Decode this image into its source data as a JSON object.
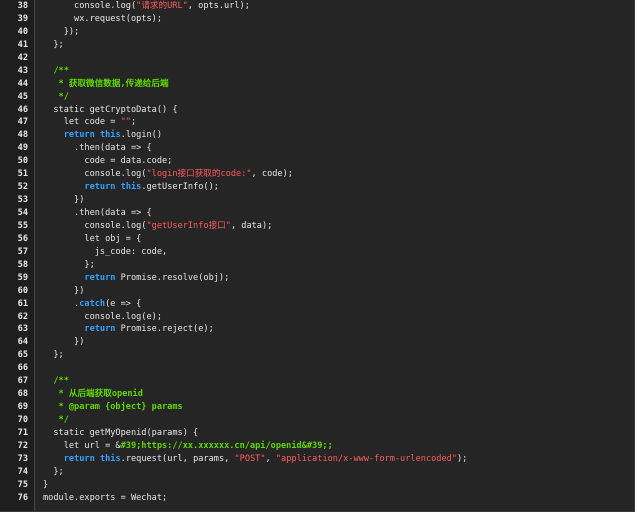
{
  "editor": {
    "lines": [
      {
        "num": "38",
        "tokens": [
          {
            "t": "      console.log(",
            "c": ""
          },
          {
            "t": "\"请求的URL\"",
            "c": "str"
          },
          {
            "t": ", opts.url);",
            "c": ""
          }
        ]
      },
      {
        "num": "39",
        "tokens": [
          {
            "t": "      wx.request(opts);",
            "c": ""
          }
        ]
      },
      {
        "num": "40",
        "tokens": [
          {
            "t": "    });",
            "c": ""
          }
        ]
      },
      {
        "num": "41",
        "tokens": [
          {
            "t": "  };",
            "c": ""
          }
        ]
      },
      {
        "num": "42",
        "tokens": []
      },
      {
        "num": "43",
        "tokens": [
          {
            "t": "  /**",
            "c": "cm"
          }
        ]
      },
      {
        "num": "44",
        "tokens": [
          {
            "t": "   * 获取微信数据,传递给后端",
            "c": "cm"
          }
        ]
      },
      {
        "num": "45",
        "tokens": [
          {
            "t": "   */",
            "c": "cm"
          }
        ]
      },
      {
        "num": "46",
        "tokens": [
          {
            "t": "  static getCryptoData() {",
            "c": ""
          }
        ]
      },
      {
        "num": "47",
        "tokens": [
          {
            "t": "    let code = ",
            "c": ""
          },
          {
            "t": "\"\"",
            "c": "str"
          },
          {
            "t": ";",
            "c": ""
          }
        ]
      },
      {
        "num": "48",
        "tokens": [
          {
            "t": "    ",
            "c": ""
          },
          {
            "t": "return",
            "c": "kw"
          },
          {
            "t": " ",
            "c": ""
          },
          {
            "t": "this",
            "c": "kw"
          },
          {
            "t": ".login()",
            "c": ""
          }
        ]
      },
      {
        "num": "49",
        "tokens": [
          {
            "t": "      .then(data => {",
            "c": ""
          }
        ]
      },
      {
        "num": "50",
        "tokens": [
          {
            "t": "        code = data.code;",
            "c": ""
          }
        ]
      },
      {
        "num": "51",
        "tokens": [
          {
            "t": "        console.log(",
            "c": ""
          },
          {
            "t": "\"login接口获取的code:\"",
            "c": "str"
          },
          {
            "t": ", code);",
            "c": ""
          }
        ]
      },
      {
        "num": "52",
        "tokens": [
          {
            "t": "        ",
            "c": ""
          },
          {
            "t": "return",
            "c": "kw"
          },
          {
            "t": " ",
            "c": ""
          },
          {
            "t": "this",
            "c": "kw"
          },
          {
            "t": ".getUserInfo();",
            "c": ""
          }
        ]
      },
      {
        "num": "53",
        "tokens": [
          {
            "t": "      })",
            "c": ""
          }
        ]
      },
      {
        "num": "54",
        "tokens": [
          {
            "t": "      .then(data => {",
            "c": ""
          }
        ]
      },
      {
        "num": "55",
        "tokens": [
          {
            "t": "        console.log(",
            "c": ""
          },
          {
            "t": "\"getUserInfo接口\"",
            "c": "str"
          },
          {
            "t": ", data);",
            "c": ""
          }
        ]
      },
      {
        "num": "56",
        "tokens": [
          {
            "t": "        let obj = {",
            "c": ""
          }
        ]
      },
      {
        "num": "57",
        "tokens": [
          {
            "t": "          js_code: code,",
            "c": ""
          }
        ]
      },
      {
        "num": "58",
        "tokens": [
          {
            "t": "        };",
            "c": ""
          }
        ]
      },
      {
        "num": "59",
        "tokens": [
          {
            "t": "        ",
            "c": ""
          },
          {
            "t": "return",
            "c": "kw"
          },
          {
            "t": " Promise.resolve(obj);",
            "c": ""
          }
        ]
      },
      {
        "num": "60",
        "tokens": [
          {
            "t": "      })",
            "c": ""
          }
        ]
      },
      {
        "num": "61",
        "tokens": [
          {
            "t": "      .",
            "c": ""
          },
          {
            "t": "catch",
            "c": "kw"
          },
          {
            "t": "(e => {",
            "c": ""
          }
        ]
      },
      {
        "num": "62",
        "tokens": [
          {
            "t": "        console.log(e);",
            "c": ""
          }
        ]
      },
      {
        "num": "63",
        "tokens": [
          {
            "t": "        ",
            "c": ""
          },
          {
            "t": "return",
            "c": "kw"
          },
          {
            "t": " Promise.reject(e);",
            "c": ""
          }
        ]
      },
      {
        "num": "64",
        "tokens": [
          {
            "t": "      })",
            "c": ""
          }
        ]
      },
      {
        "num": "65",
        "tokens": [
          {
            "t": "  };",
            "c": ""
          }
        ]
      },
      {
        "num": "66",
        "tokens": []
      },
      {
        "num": "67",
        "tokens": [
          {
            "t": "  /**",
            "c": "cm"
          }
        ]
      },
      {
        "num": "68",
        "tokens": [
          {
            "t": "   * 从后端获取openid",
            "c": "cm"
          }
        ]
      },
      {
        "num": "69",
        "tokens": [
          {
            "t": "   * @param {object} params",
            "c": "cm"
          }
        ]
      },
      {
        "num": "70",
        "tokens": [
          {
            "t": "   */",
            "c": "cm"
          }
        ]
      },
      {
        "num": "71",
        "tokens": [
          {
            "t": "  static getMyOpenid(params) {",
            "c": ""
          }
        ]
      },
      {
        "num": "72",
        "tokens": [
          {
            "t": "    let url = &",
            "c": ""
          },
          {
            "t": "#39;https://xx.xxxxxx.cn/api/openid&#39;;",
            "c": "cm"
          }
        ]
      },
      {
        "num": "73",
        "tokens": [
          {
            "t": "    ",
            "c": ""
          },
          {
            "t": "return",
            "c": "kw"
          },
          {
            "t": " ",
            "c": ""
          },
          {
            "t": "this",
            "c": "kw"
          },
          {
            "t": ".request(url, params, ",
            "c": ""
          },
          {
            "t": "\"POST\"",
            "c": "str"
          },
          {
            "t": ", ",
            "c": ""
          },
          {
            "t": "\"application/x-www-form-urlencoded\"",
            "c": "str"
          },
          {
            "t": ");",
            "c": ""
          }
        ]
      },
      {
        "num": "74",
        "tokens": [
          {
            "t": "  };",
            "c": ""
          }
        ]
      },
      {
        "num": "75",
        "tokens": [
          {
            "t": "}",
            "c": ""
          }
        ]
      },
      {
        "num": "76",
        "tokens": [
          {
            "t": "module.exports = Wechat;",
            "c": ""
          }
        ]
      }
    ]
  }
}
